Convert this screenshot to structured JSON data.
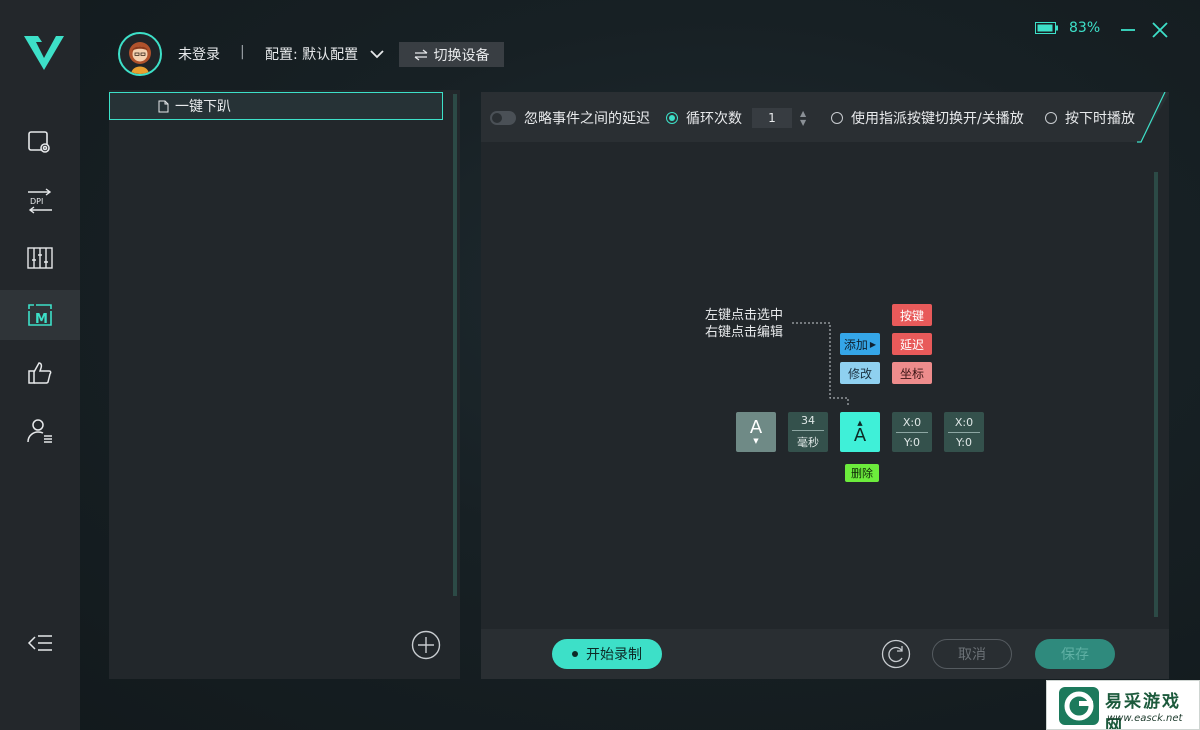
{
  "header": {
    "login_status": "未登录",
    "separator": "|",
    "config_label": "配置: 默认配置",
    "switch_device": "切换设备",
    "battery": "83%"
  },
  "sidebar": {
    "items": [
      {
        "name": "device-settings",
        "active": false
      },
      {
        "name": "dpi",
        "text": "DPI",
        "active": false
      },
      {
        "name": "equalizer",
        "active": false
      },
      {
        "name": "macro",
        "text": "M",
        "active": true
      },
      {
        "name": "like",
        "active": false
      },
      {
        "name": "account",
        "active": false
      }
    ]
  },
  "macro_list": {
    "items": [
      "一键下趴"
    ]
  },
  "toolbar": {
    "ignore_delay": "忽略事件之间的延迟",
    "loop_count": "循环次数",
    "loop_value": "1",
    "toggle_play": "使用指派按键切换开/关播放",
    "hold_play": "按下时播放"
  },
  "canvas": {
    "hint_line1": "左键点击选中",
    "hint_line2": "右键点击编辑",
    "add": "添加",
    "modify": "修改",
    "menu_key": "按键",
    "menu_delay": "延迟",
    "menu_coord": "坐标",
    "delete": "删除",
    "events": [
      {
        "type": "key-down",
        "label": "A"
      },
      {
        "type": "delay",
        "value": "34",
        "unit": "毫秒"
      },
      {
        "type": "key-up",
        "label": "A"
      },
      {
        "type": "coord",
        "x": "X:0",
        "y": "Y:0"
      },
      {
        "type": "coord",
        "x": "X:0",
        "y": "Y:0"
      }
    ]
  },
  "footer": {
    "record": "开始录制",
    "cancel": "取消",
    "save": "保存"
  },
  "watermark": {
    "title": "易采游戏网",
    "url": "www.easck.net"
  },
  "colors": {
    "accent": "#3de0c8",
    "sidebar_bg": "#23272b",
    "panel_bg": "#22272b"
  }
}
